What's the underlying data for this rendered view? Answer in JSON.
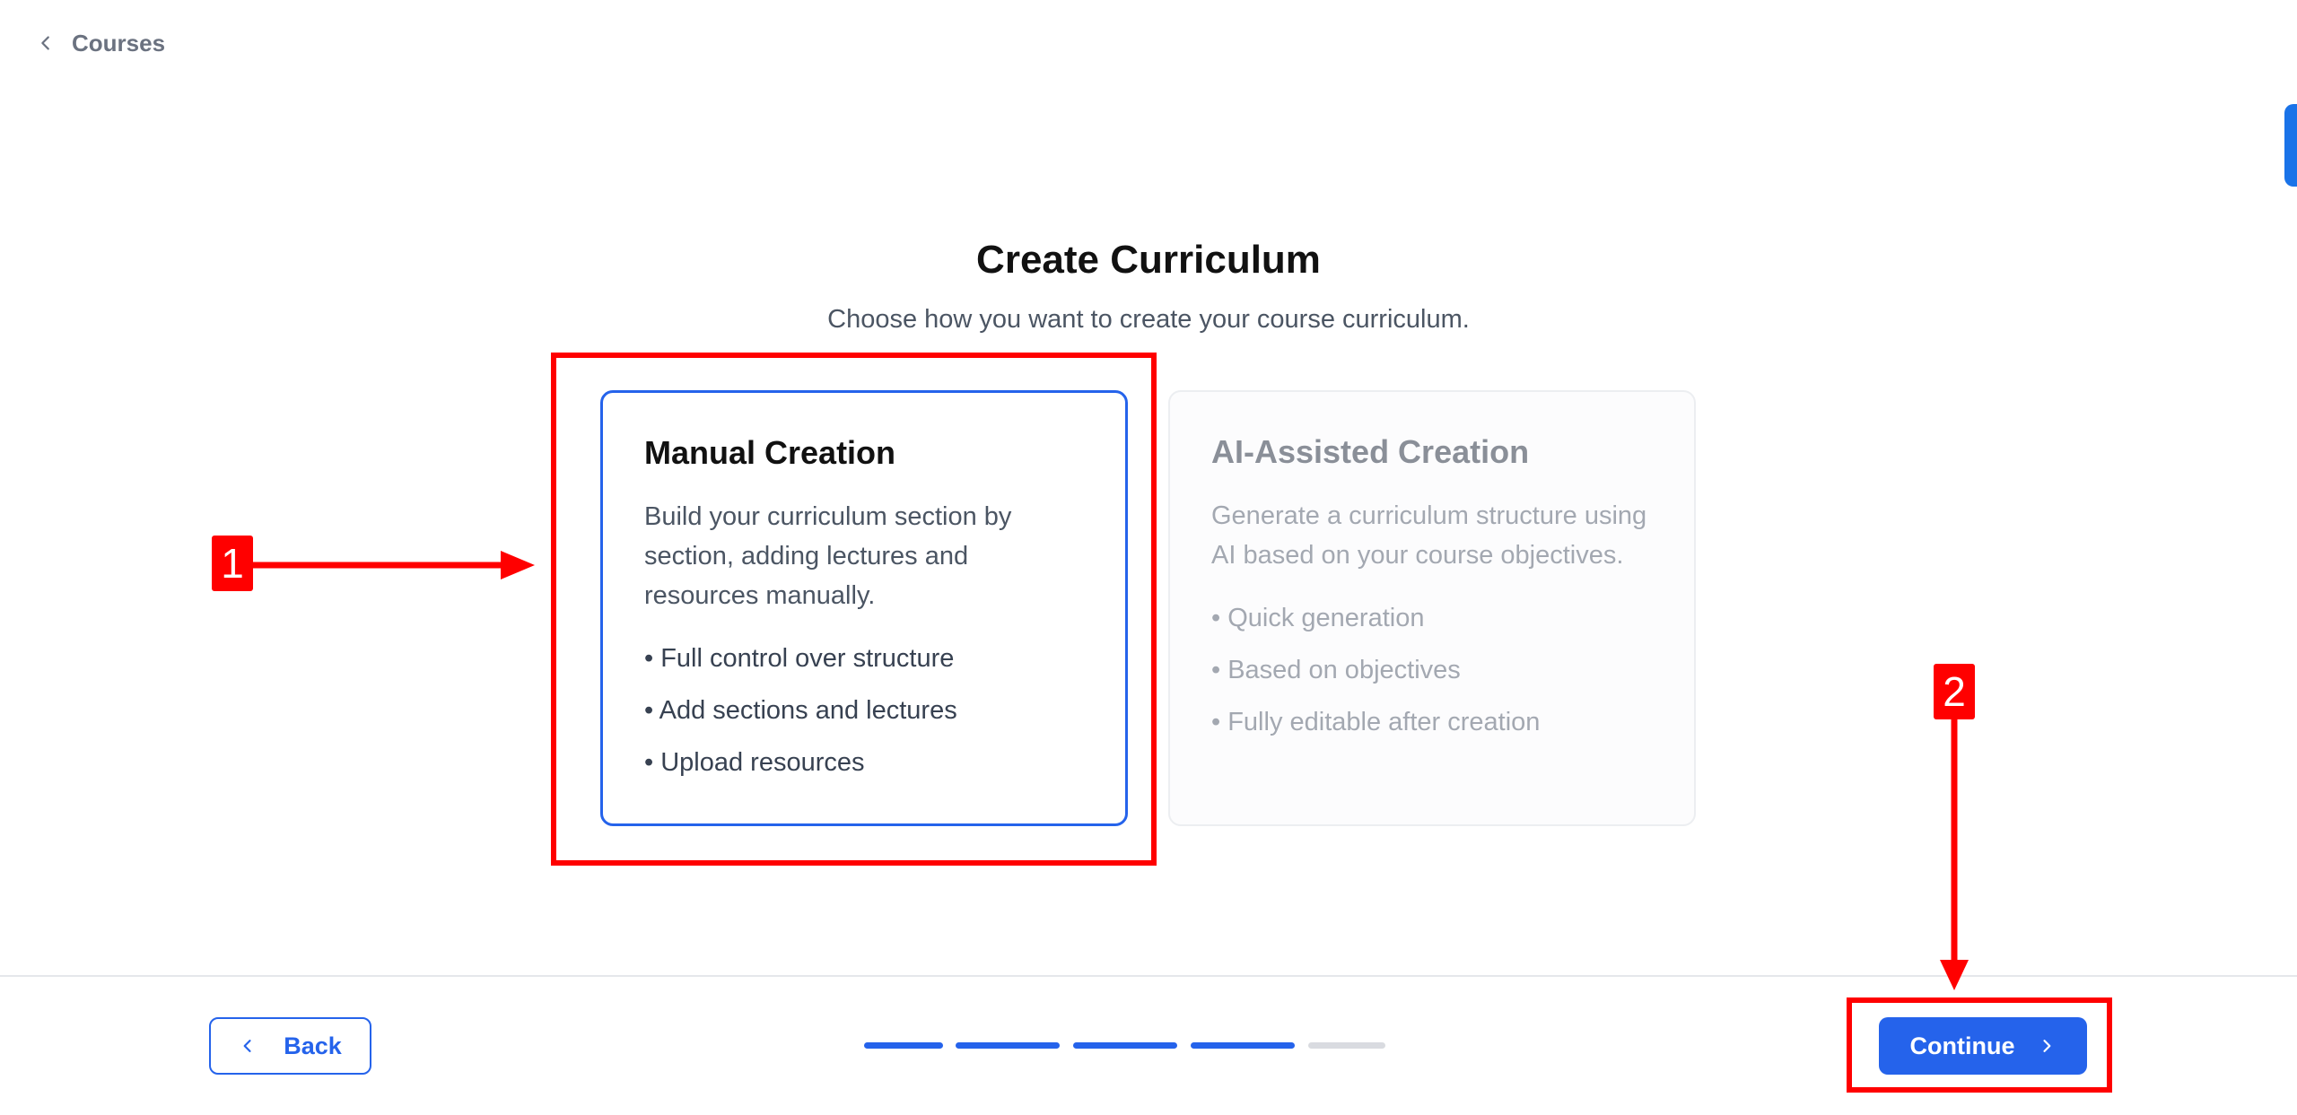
{
  "breadcrumb": {
    "label": "Courses",
    "icon": "chevron-left-icon"
  },
  "header": {
    "title": "Create Curriculum",
    "subtitle": "Choose how you want to create your course curriculum."
  },
  "options": [
    {
      "id": "manual",
      "title": "Manual Creation",
      "description": "Build your curriculum section by section, adding lectures and resources manually.",
      "features": [
        "• Full control over structure",
        "• Add sections and lectures",
        "• Upload resources"
      ],
      "selected": true
    },
    {
      "id": "ai",
      "title": "AI-Assisted Creation",
      "description": "Generate a curriculum structure using AI based on your course objectives.",
      "features": [
        "• Quick generation",
        "• Based on objectives",
        "• Fully editable after creation"
      ],
      "selected": false
    }
  ],
  "annotations": {
    "badge_1": "1",
    "badge_2": "2",
    "color": "#ff0000"
  },
  "footer": {
    "back_label": "Back",
    "continue_label": "Continue",
    "progress": {
      "total_steps": 5,
      "completed_steps": 4,
      "active_color": "#2563eb",
      "inactive_color": "#d9dbe0"
    }
  },
  "colors": {
    "accent": "#2563eb"
  }
}
